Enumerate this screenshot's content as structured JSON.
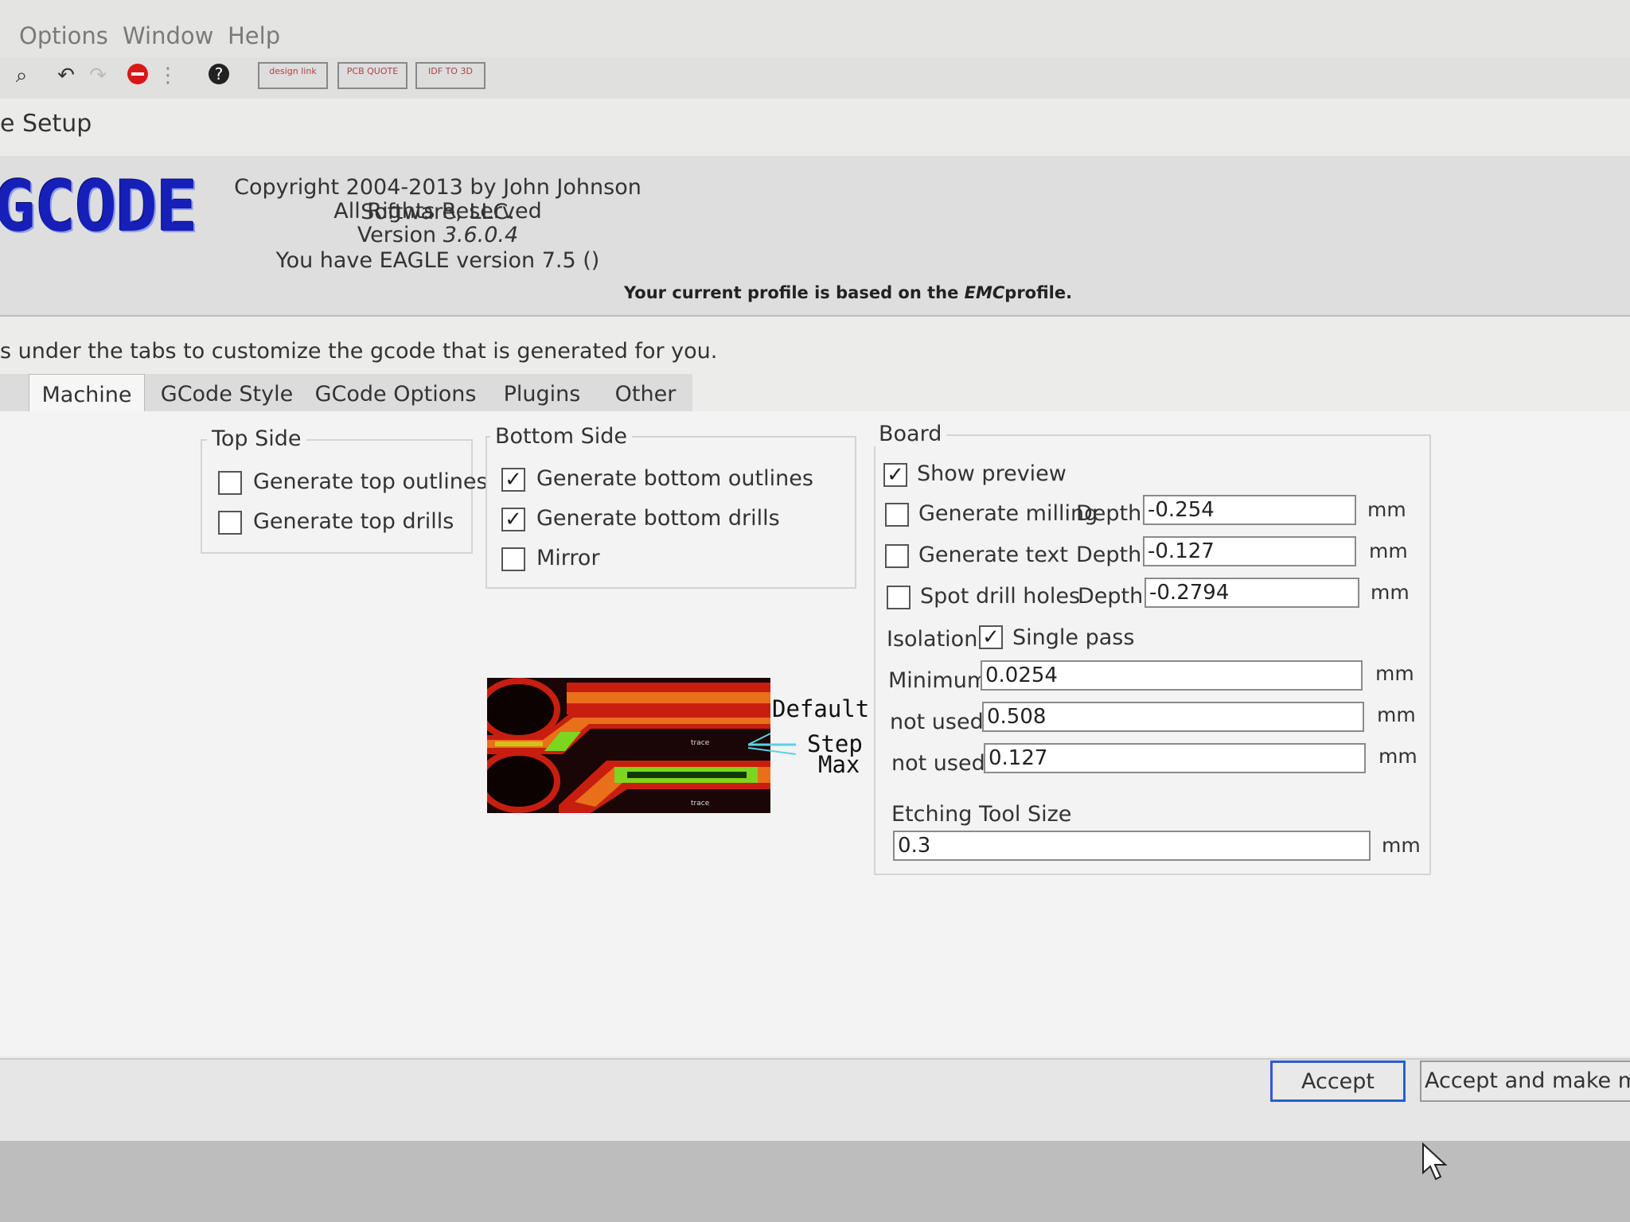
{
  "menu": [
    "Options",
    "Window",
    "Help"
  ],
  "toolbar": {
    "buttons": [
      {
        "icon": "zoom-icon"
      },
      {
        "icon": "undo-icon"
      },
      {
        "icon": "redo-icon"
      },
      {
        "icon": "stop-icon"
      },
      {
        "icon": "dots-icon"
      },
      {
        "icon": "help-icon"
      }
    ],
    "design_link": "design link",
    "pcb_quote": "PCB QUOTE",
    "idf_3d": "IDF TO 3D"
  },
  "dialog": {
    "title": "e Setup",
    "logo": "GCODE",
    "copyright": "Copyright 2004-2013 by John Johnson Software, LLC.",
    "rights": "All Rights Reserved",
    "version_label": "Version",
    "version": "3.6.0.4",
    "eagle_version": "You have EAGLE version 7.5 ()",
    "profile_prefix": "Your current profile is based on the",
    "profile_name": "EMC",
    "profile_suffix": "profile.",
    "instructions": "s under the tabs to customize the gcode that is generated for you."
  },
  "tabs": [
    {
      "label": "Machine",
      "active": true
    },
    {
      "label": "GCode Style",
      "active": false
    },
    {
      "label": "GCode Options",
      "active": false
    },
    {
      "label": "Plugins",
      "active": false
    },
    {
      "label": "Other",
      "active": false
    }
  ],
  "top_side": {
    "label": "Top Side",
    "outlines": {
      "label": "Generate top outlines",
      "checked": false
    },
    "drills": {
      "label": "Generate top drills",
      "checked": false
    }
  },
  "bottom_side": {
    "label": "Bottom Side",
    "outlines": {
      "label": "Generate bottom outlines",
      "checked": true
    },
    "drills": {
      "label": "Generate bottom drills",
      "checked": true
    },
    "mirror": {
      "label": "Mirror",
      "checked": false
    }
  },
  "preview_legend": {
    "default": "Default",
    "step": "Step",
    "max": "Max",
    "trace": "trace"
  },
  "board": {
    "label": "Board",
    "show_preview": {
      "label": "Show preview",
      "checked": true
    },
    "milling": {
      "label": "Generate milling",
      "checked": false,
      "depth_label": "Depth",
      "depth": "-0.254",
      "unit": "mm"
    },
    "text": {
      "label": "Generate text",
      "checked": false,
      "depth_label": "Depth",
      "depth": "-0.127",
      "unit": "mm"
    },
    "spot": {
      "label": "Spot drill holes",
      "checked": false,
      "depth_label": "Depth",
      "depth": "-0.2794",
      "unit": "mm"
    },
    "isolation_label": "Isolation",
    "single_pass": {
      "label": "Single pass",
      "checked": true
    },
    "minimum": {
      "label": "Minimum",
      "value": "0.0254",
      "unit": "mm"
    },
    "not_used_1": {
      "label": "not used",
      "value": "0.508",
      "unit": "mm"
    },
    "not_used_2": {
      "label": "not used",
      "value": "0.127",
      "unit": "mm"
    },
    "etching_label": "Etching Tool Size",
    "etching": {
      "value": "0.3",
      "unit": "mm"
    }
  },
  "footer": {
    "accept": "Accept",
    "accept_make": "Accept and make my bo"
  },
  "colors": {
    "logo": "#1620b8",
    "accept_border": "#2a5bd8",
    "trace_red": "#c81e10",
    "trace_orange": "#e8701a",
    "trace_green": "#7cd61e"
  }
}
